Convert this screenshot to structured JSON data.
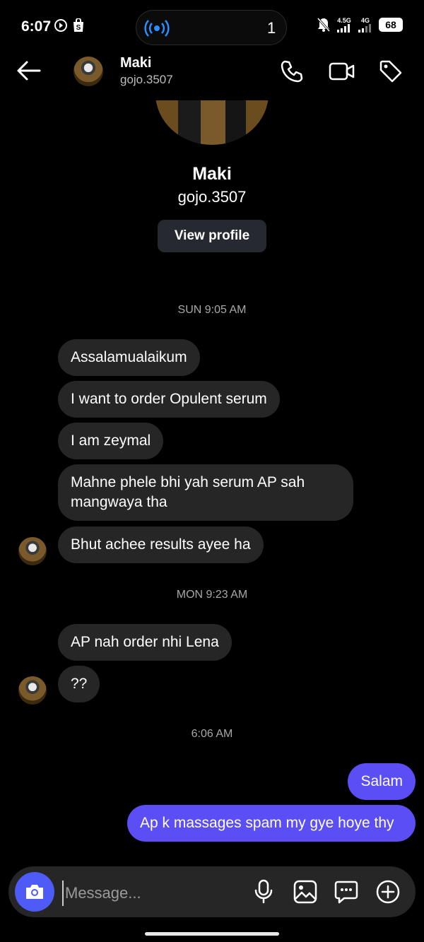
{
  "status_bar": {
    "time": "6:07",
    "live_count": "1",
    "network_1": "4.5G",
    "network_2": "4G",
    "battery": "68"
  },
  "header": {
    "name": "Maki",
    "username": "gojo.3507"
  },
  "profile": {
    "name": "Maki",
    "username": "gojo.3507",
    "view_profile_label": "View profile"
  },
  "timestamps": {
    "t1": "SUN 9:05 AM",
    "t2": "MON 9:23 AM",
    "t3": "6:06 AM"
  },
  "messages": [
    {
      "text": "Assalamualaikum",
      "dir": "in"
    },
    {
      "text": "I want to order Opulent serum",
      "dir": "in"
    },
    {
      "text": "I am zeymal",
      "dir": "in"
    },
    {
      "text": "Mahne phele bhi yah serum AP sah mangwaya tha",
      "dir": "in"
    },
    {
      "text": "Bhut achee results ayee ha",
      "dir": "in"
    },
    {
      "text": "AP nah order nhi Lena",
      "dir": "in"
    },
    {
      "text": "??",
      "dir": "in"
    },
    {
      "text": "Salam",
      "dir": "out"
    },
    {
      "text": "Ap k massages spam my gye hoye thy",
      "dir": "out"
    }
  ],
  "composer": {
    "placeholder": "Message..."
  },
  "colors": {
    "background": "#000000",
    "incoming_bubble": "#262626",
    "outgoing_bubble": "#5b4ef5",
    "camera_button": "#4f5bf7"
  }
}
